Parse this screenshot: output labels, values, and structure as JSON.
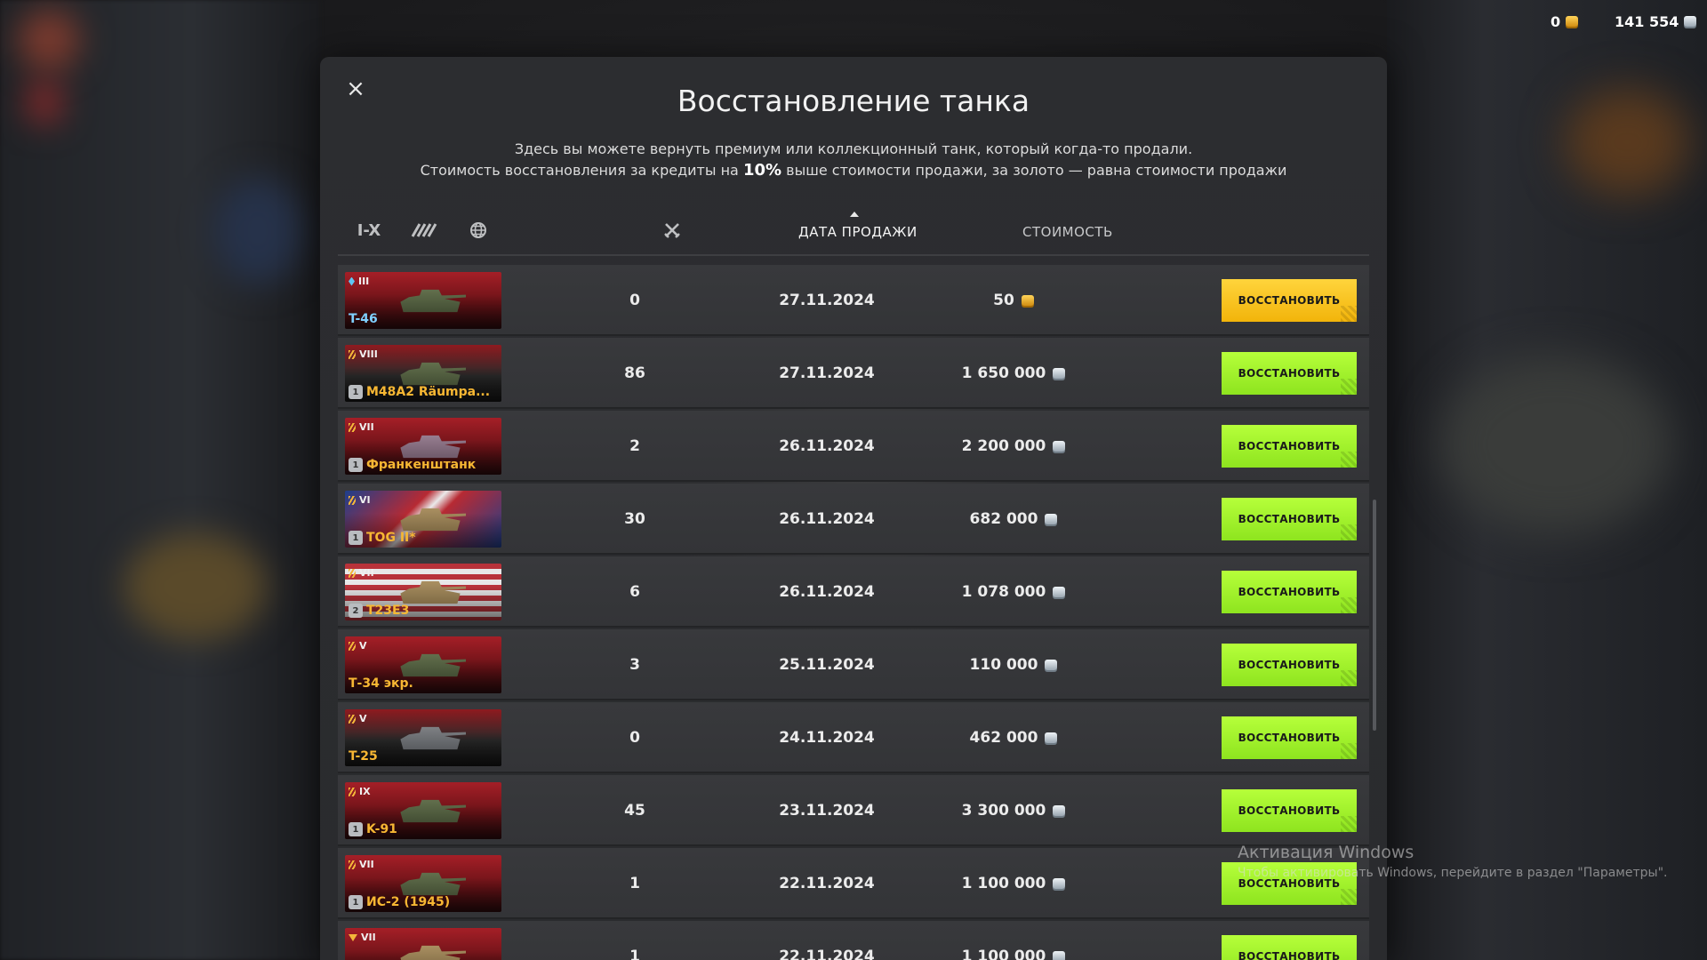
{
  "currency": {
    "gold": "0",
    "credits": "141 554"
  },
  "modal": {
    "title": "Восстановление танка",
    "subtitle_line1": "Здесь вы можете вернуть премиум или коллекционный танк, который когда-то продали.",
    "subtitle_line2_a": "Стоимость восстановления за кредиты на",
    "subtitle_line2_bold": "10%",
    "subtitle_line2_b": "выше стоимости продажи, за золото — равна стоимости продажи"
  },
  "filters": {
    "tier_label": "I-X"
  },
  "columns": {
    "date": "ДАТА ПРОДАЖИ",
    "price": "СТОИМОСТЬ"
  },
  "restore_label": "ВОССТАНОВИТЬ",
  "rows": [
    {
      "tier": "III",
      "name": "T-46",
      "battles": "0",
      "date": "27.11.2024",
      "price": "50",
      "currency": "gold"
    },
    {
      "tier": "VIII",
      "name": "M48A2 Räumpa...",
      "battles": "86",
      "date": "27.11.2024",
      "price": "1 650 000",
      "currency": "credits",
      "badge": "1"
    },
    {
      "tier": "VII",
      "name": "Франкенштанк",
      "battles": "2",
      "date": "26.11.2024",
      "price": "2 200 000",
      "currency": "credits",
      "badge": "1"
    },
    {
      "tier": "VI",
      "name": "TOG II*",
      "battles": "30",
      "date": "26.11.2024",
      "price": "682 000",
      "currency": "credits",
      "badge": "1"
    },
    {
      "tier": "VII",
      "name": "T23E3",
      "battles": "6",
      "date": "26.11.2024",
      "price": "1 078 000",
      "currency": "credits",
      "badge": "2"
    },
    {
      "tier": "V",
      "name": "Т-34 экр.",
      "battles": "3",
      "date": "25.11.2024",
      "price": "110 000",
      "currency": "credits"
    },
    {
      "tier": "V",
      "name": "T-25",
      "battles": "0",
      "date": "24.11.2024",
      "price": "462 000",
      "currency": "credits"
    },
    {
      "tier": "IX",
      "name": "K-91",
      "battles": "45",
      "date": "23.11.2024",
      "price": "3 300 000",
      "currency": "credits",
      "badge": "1"
    },
    {
      "tier": "VII",
      "name": "ИС-2 (1945)",
      "battles": "1",
      "date": "22.11.2024",
      "price": "1 100 000",
      "currency": "credits",
      "badge": "1"
    },
    {
      "tier": "VII",
      "name": "",
      "battles": "1",
      "date": "22.11.2024",
      "price": "1 100 000",
      "currency": "credits"
    }
  ],
  "windows_watermark": {
    "line1": "Активация Windows",
    "line2": "Чтобы активировать Windows, перейдите в раздел \"Параметры\"."
  }
}
